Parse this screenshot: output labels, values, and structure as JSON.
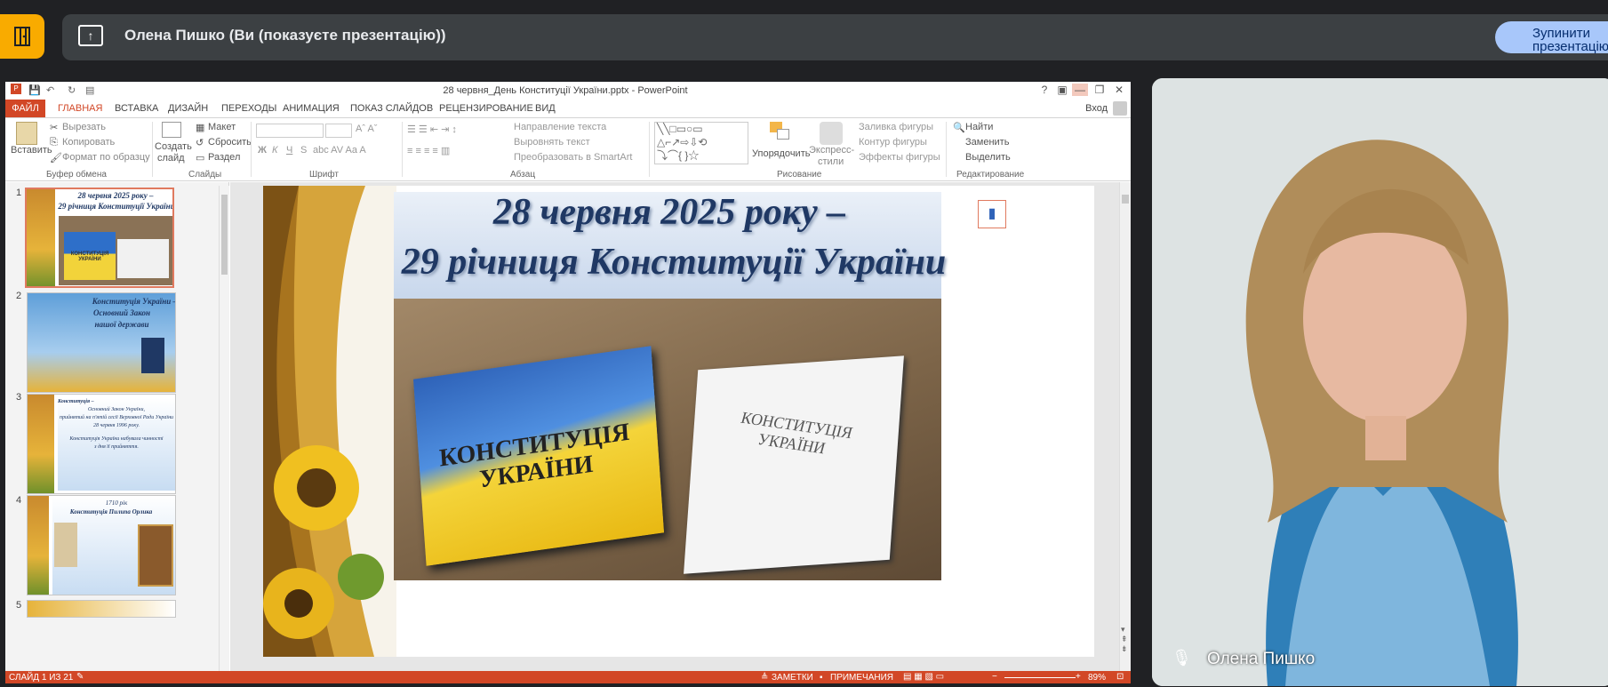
{
  "meet": {
    "presenter_title": "Олена Пишко (Ви (показуєте презентацію))",
    "stop_button_line1": "Зупинити",
    "stop_button_line2": "презентацію",
    "participant_name": "Олена Пишко"
  },
  "ppt": {
    "window_title": "28 червня_День Конституції України.pptx - PowerPoint",
    "login": "Вход",
    "tabs": [
      "ФАЙЛ",
      "ГЛАВНАЯ",
      "ВСТАВКА",
      "ДИЗАЙН",
      "ПЕРЕХОДЫ",
      "АНИМАЦИЯ",
      "ПОКАЗ СЛАЙДОВ",
      "РЕЦЕНЗИРОВАНИЕ",
      "ВИД"
    ],
    "active_tab": "ГЛАВНАЯ",
    "ribbon": {
      "paste": "Вставить",
      "cut": "Вырезать",
      "copy": "Копировать",
      "format_painter": "Формат по образцу",
      "clipboard_group": "Буфер обмена",
      "new_slide_1": "Создать",
      "new_slide_2": "слайд",
      "layout": "Макет",
      "reset": "Сбросить",
      "section": "Раздел",
      "slides_group": "Слайды",
      "font_group": "Шрифт",
      "text_direction": "Направление текста",
      "align_text": "Выровнять текст",
      "smartart": "Преобразовать в SmartArt",
      "paragraph_group": "Абзац",
      "arrange": "Упорядочить",
      "quick_styles_1": "Экспресс-",
      "quick_styles_2": "стили",
      "shape_fill": "Заливка фигуры",
      "shape_outline": "Контур фигуры",
      "shape_effects": "Эффекты фигуры",
      "drawing_group": "Рисование",
      "find": "Найти",
      "replace": "Заменить",
      "select": "Выделить",
      "editing_group": "Редактирование",
      "bold": "Ж",
      "italic": "К",
      "underline": "Ч",
      "strike": "S"
    },
    "thumbnails": [
      {
        "num": "1",
        "line1": "28 червня 2025 року –",
        "line2": "29 річниця Конституції України",
        "book": "КОНСТИТУЦІЯ УКРАЇНИ"
      },
      {
        "num": "2",
        "line1": "Конституція України –",
        "line2": "Основний Закон",
        "line3": "нашої держави"
      },
      {
        "num": "3",
        "line1": "Конституція –",
        "line2": "Основний Закон України,",
        "line3": "прийнятий на п'ятій сесії Верховної Ради України",
        "line4": "28 червня 1996 року.",
        "line5": "Конституція України набувала чинності",
        "line6": "з дня її прийняття."
      },
      {
        "num": "4",
        "line1": "1710 рік",
        "line2": "Конституція Пилипа Орлика"
      },
      {
        "num": "5"
      }
    ],
    "slide": {
      "title_line1": "28 червня 2025 року –",
      "title_line2": "29 річниця Конституції України",
      "book_left": "КОНСТИТУЦІЯ УКРАЇНИ",
      "book_right": "КОНСТИТУЦІЯ УКРАЇНИ"
    },
    "status": {
      "slide_counter": "СЛАЙД 1 ИЗ 21",
      "notes": "ЗАМЕТКИ",
      "comments": "ПРИМЕЧАНИЯ",
      "zoom": "89%"
    }
  },
  "colors": {
    "accent": "#d24726",
    "meet_yellow": "#f9ab00",
    "stop_button": "#a8c7fa",
    "title_blue": "#1f3864"
  }
}
